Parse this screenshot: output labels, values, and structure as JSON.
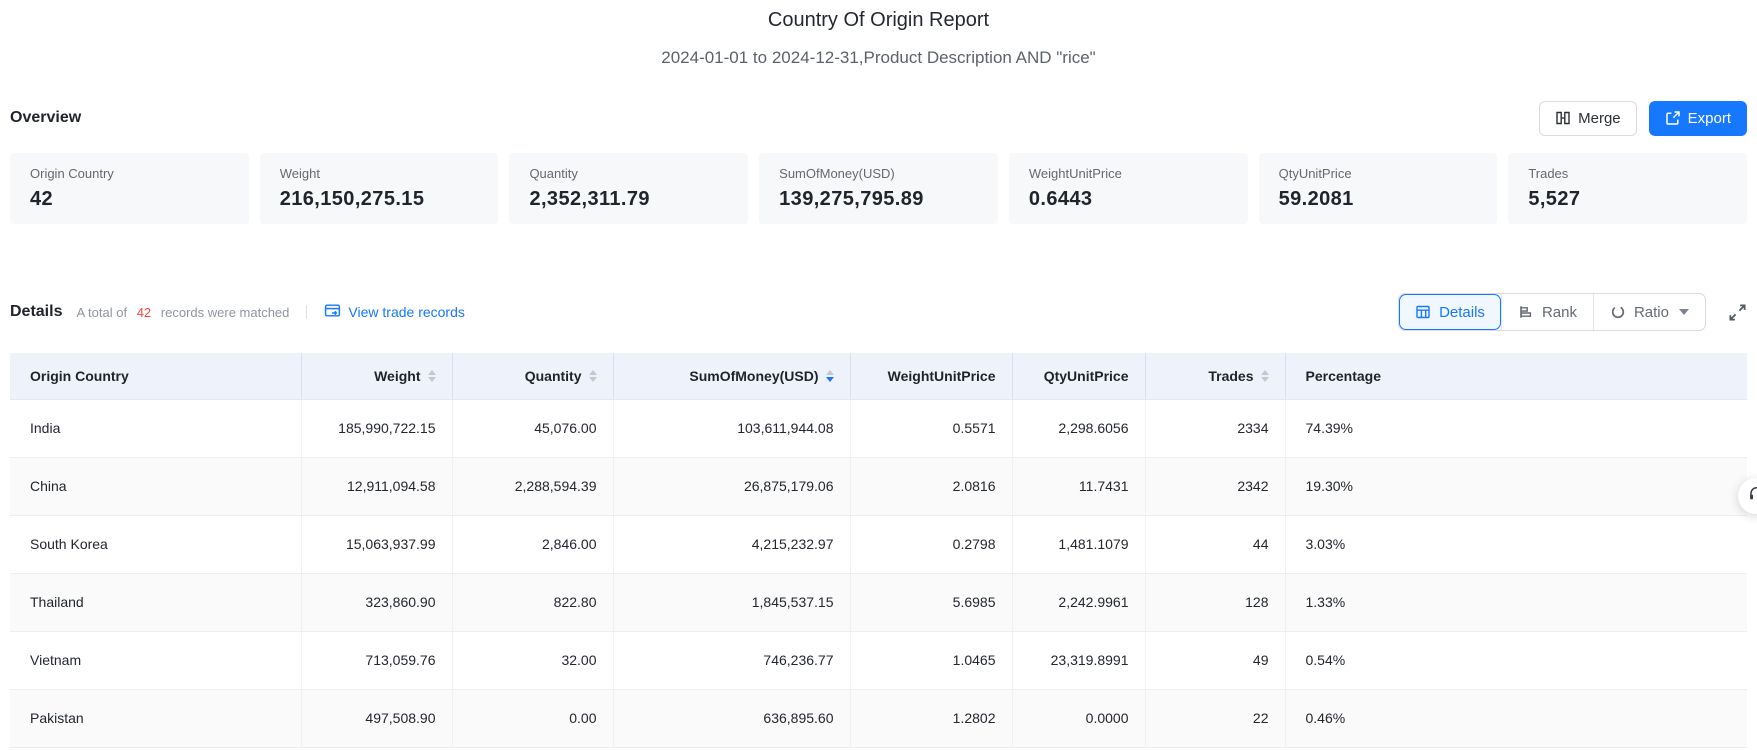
{
  "page": {
    "title": "Country Of Origin Report",
    "subtitle": "2024-01-01 to 2024-12-31,Product Description AND \"rice\""
  },
  "toolbar": {
    "merge_label": "Merge",
    "export_label": "Export"
  },
  "overview": {
    "heading": "Overview",
    "cards": [
      {
        "label": "Origin Country",
        "value": "42"
      },
      {
        "label": "Weight",
        "value": "216,150,275.15"
      },
      {
        "label": "Quantity",
        "value": "2,352,311.79"
      },
      {
        "label": "SumOfMoney(USD)",
        "value": "139,275,795.89"
      },
      {
        "label": "WeightUnitPrice",
        "value": "0.6443"
      },
      {
        "label": "QtyUnitPrice",
        "value": "59.2081"
      },
      {
        "label": "Trades",
        "value": "5,527"
      }
    ]
  },
  "details": {
    "heading": "Details",
    "summary_prefix": "A total of",
    "matched_count": "42",
    "summary_suffix": "records were matched",
    "view_link_label": "View trade records",
    "tabs": [
      {
        "label": "Details",
        "active": true
      },
      {
        "label": "Rank",
        "active": false
      },
      {
        "label": "Ratio",
        "active": false,
        "has_dropdown": true
      }
    ]
  },
  "table": {
    "columns": [
      {
        "key": "origin-country",
        "label": "Origin Country",
        "align": "left",
        "sortable": false,
        "sort": ""
      },
      {
        "key": "weight",
        "label": "Weight",
        "align": "right",
        "sortable": true,
        "sort": ""
      },
      {
        "key": "quantity",
        "label": "Quantity",
        "align": "right",
        "sortable": true,
        "sort": ""
      },
      {
        "key": "sum-of-money-usd",
        "label": "SumOfMoney(USD)",
        "align": "right",
        "sortable": true,
        "sort": "desc"
      },
      {
        "key": "weight-unit-price",
        "label": "WeightUnitPrice",
        "align": "right",
        "sortable": false,
        "sort": ""
      },
      {
        "key": "qty-unit-price",
        "label": "QtyUnitPrice",
        "align": "right",
        "sortable": false,
        "sort": ""
      },
      {
        "key": "trades",
        "label": "Trades",
        "align": "right",
        "sortable": true,
        "sort": ""
      },
      {
        "key": "percentage",
        "label": "Percentage",
        "align": "left",
        "sortable": false,
        "sort": ""
      }
    ],
    "rows": [
      [
        "India",
        "185,990,722.15",
        "45,076.00",
        "103,611,944.08",
        "0.5571",
        "2,298.6056",
        "2334",
        "74.39%"
      ],
      [
        "China",
        "12,911,094.58",
        "2,288,594.39",
        "26,875,179.06",
        "2.0816",
        "11.7431",
        "2342",
        "19.30%"
      ],
      [
        "South Korea",
        "15,063,937.99",
        "2,846.00",
        "4,215,232.97",
        "0.2798",
        "1,481.1079",
        "44",
        "3.03%"
      ],
      [
        "Thailand",
        "323,860.90",
        "822.80",
        "1,845,537.15",
        "5.6985",
        "2,242.9961",
        "128",
        "1.33%"
      ],
      [
        "Vietnam",
        "713,059.76",
        "32.00",
        "746,236.77",
        "1.0465",
        "23,319.8991",
        "49",
        "0.54%"
      ],
      [
        "Pakistan",
        "497,508.90",
        "0.00",
        "636,895.60",
        "1.2802",
        "0.0000",
        "22",
        "0.46%"
      ]
    ]
  },
  "colors": {
    "primary": "#1677ff",
    "count_red": "#f54a45",
    "table_header_bg": "#eef3fb",
    "card_bg": "#f7f8fa"
  }
}
